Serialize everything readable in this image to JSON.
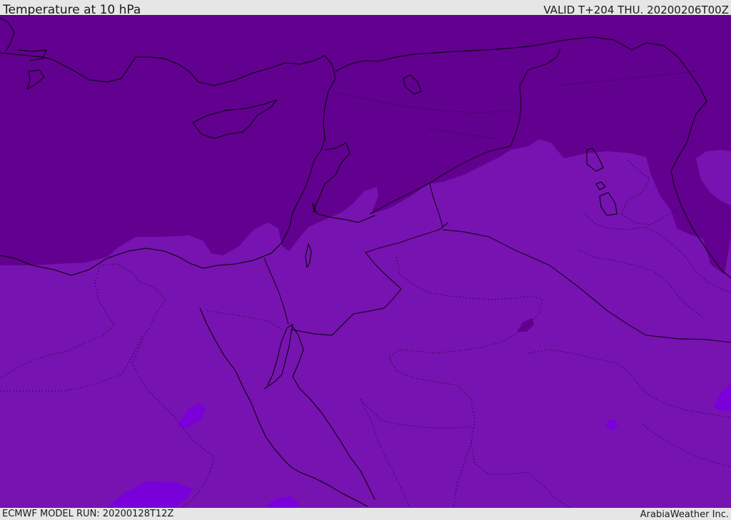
{
  "header": {
    "title": "Temperature at 10 hPa",
    "valid": "VALID T+204 THU. 20200206T00Z"
  },
  "footer": {
    "model_run": "ECMWF MODEL RUN: 20200128T12Z",
    "credit": "ArabiaWeather Inc."
  },
  "colors": {
    "band_cold": "#62008f",
    "band_mid": "#7713b0",
    "band_warm": "#7a00d9",
    "background": "#e6e6e6"
  }
}
